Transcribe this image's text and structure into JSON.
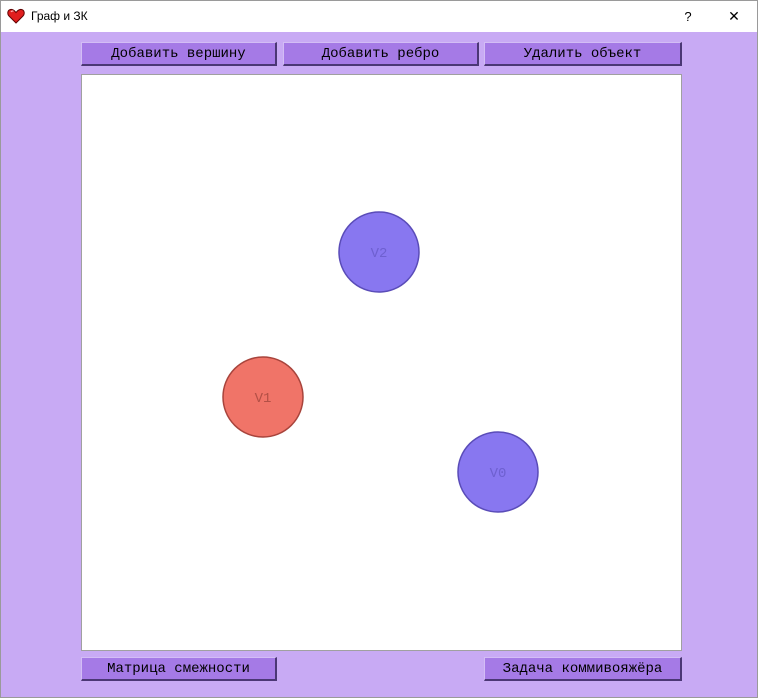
{
  "window": {
    "title": "Граф и ЗК",
    "help_label": "?",
    "close_label": "✕"
  },
  "toolbar": {
    "add_vertex": "Добавить вершину",
    "add_edge": "Добавить ребро",
    "delete_object": "Удалить объект"
  },
  "footer": {
    "adjacency_matrix": "Матрица смежности",
    "tsp": "Задача коммивояжёра"
  },
  "graph": {
    "vertices": [
      {
        "label": "V0",
        "color": "#8877f0",
        "stroke": "#5a4cb8",
        "text_color": "#6e60d0"
      },
      {
        "label": "V1",
        "color": "#f07468",
        "stroke": "#a8443c",
        "text_color": "#b35046"
      },
      {
        "label": "V2",
        "color": "#8877f0",
        "stroke": "#5a4cb8",
        "text_color": "#6e60d0"
      }
    ],
    "edges": []
  },
  "colors": {
    "background": "#c8aaf4",
    "button": "#a57ae6",
    "selected_vertex": "#f07468",
    "vertex": "#8877f0"
  }
}
